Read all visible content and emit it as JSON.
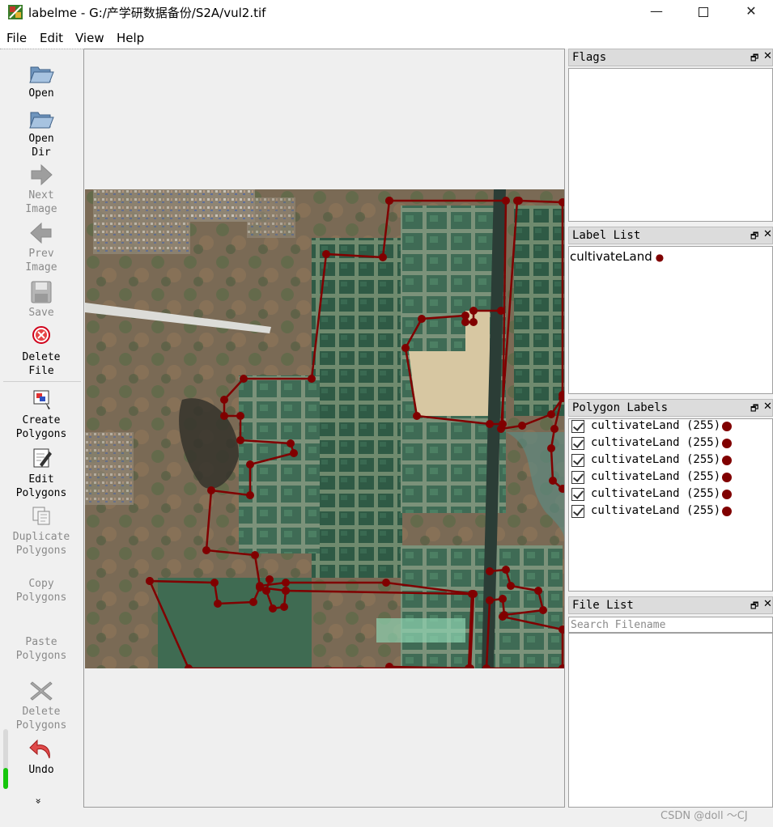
{
  "window": {
    "title": "labelme - G:/产学研数据备份/S2A/vul2.tif",
    "minimize_glyph": "—",
    "close_glyph": "✕"
  },
  "menu": [
    "File",
    "Edit",
    "View",
    "Help"
  ],
  "toolbar": {
    "open": "Open",
    "open_dir": [
      "Open",
      "Dir"
    ],
    "next_image": [
      "Next",
      "Image"
    ],
    "prev_image": [
      "Prev",
      "Image"
    ],
    "save": "Save",
    "delete_file": [
      "Delete",
      "File"
    ],
    "create_polygons": [
      "Create",
      "Polygons"
    ],
    "edit_polygons": [
      "Edit",
      "Polygons"
    ],
    "duplicate_polygons": [
      "Duplicate",
      "Polygons"
    ],
    "copy_polygons": [
      "Copy",
      "Polygons"
    ],
    "paste_polygons": [
      "Paste",
      "Polygons"
    ],
    "delete_polygons": [
      "Delete",
      "Polygons"
    ],
    "undo": "Undo",
    "more": "»",
    "zoom_level_fraction": 0.35
  },
  "docks": {
    "flags": {
      "title": "Flags"
    },
    "label_list": {
      "title": "Label List",
      "items": [
        "cultivateLand"
      ]
    },
    "polygon_labels": {
      "title": "Polygon Labels",
      "items": [
        "cultivateLand (255)",
        "cultivateLand (255)",
        "cultivateLand (255)",
        "cultivateLand (255)",
        "cultivateLand (255)",
        "cultivateLand (255)"
      ]
    },
    "file_list": {
      "title": "File List",
      "search_placeholder": "Search Filename"
    },
    "float_glyph": "🗗",
    "close_glyph": "✕"
  },
  "colors": {
    "polygon": "#800000",
    "zoom_fill": "#16c60c"
  },
  "watermark": "CSDN @doll ～CJ"
}
